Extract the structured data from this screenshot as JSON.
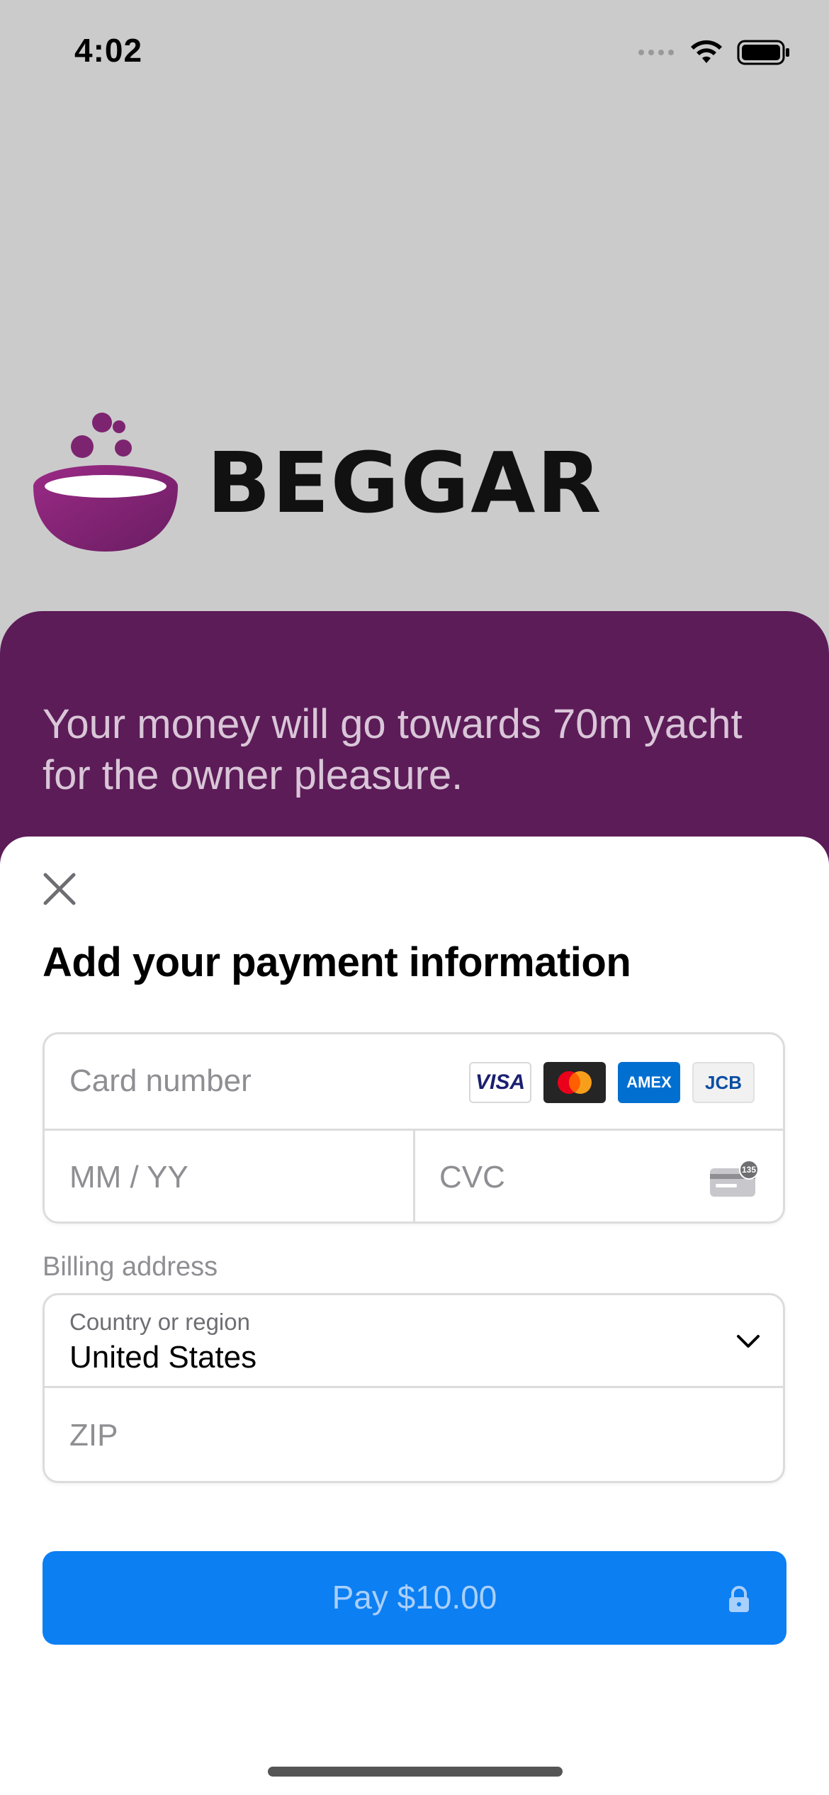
{
  "status_bar": {
    "time": "4:02"
  },
  "logo": {
    "text": "BEGGAR",
    "colors": {
      "bowl": "#8a2a7c",
      "text": "#111111"
    }
  },
  "banner": {
    "text": "Your money will go towards 70m yacht for the owner pleasure.",
    "color": "#5c1c58"
  },
  "sheet": {
    "close_icon": "close-icon",
    "title": "Add your payment information",
    "card": {
      "number_placeholder": "Card number",
      "brands": [
        "VISA",
        "Mastercard",
        "AMEX",
        "JCB"
      ],
      "visa_label": "VISA",
      "amex_label": "AMEX",
      "jcb_label": "JCB",
      "expiry_placeholder": "MM / YY",
      "cvc_placeholder": "CVC",
      "cvc_badge": "135"
    },
    "billing": {
      "label": "Billing address",
      "country_label": "Country or region",
      "country_value": "United States",
      "zip_placeholder": "ZIP"
    },
    "pay_button": {
      "label": "Pay $10.00",
      "color": "#0c7ff2"
    }
  }
}
